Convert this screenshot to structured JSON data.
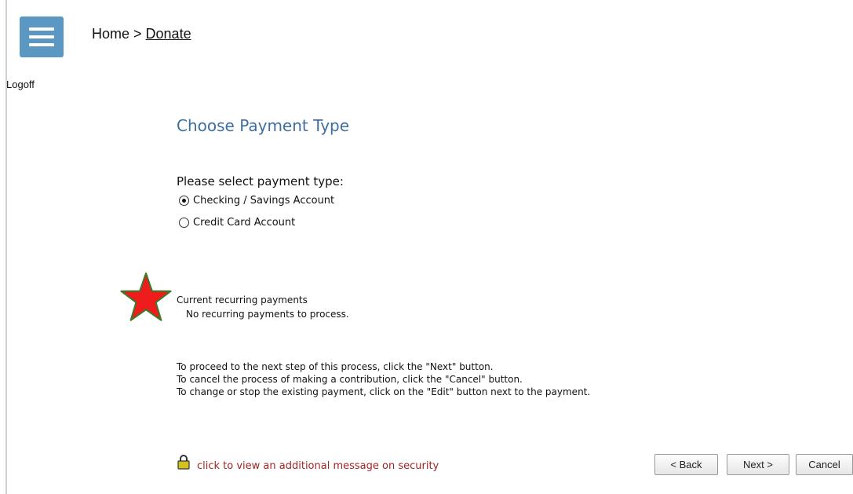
{
  "header": {
    "breadcrumb_home": "Home",
    "breadcrumb_separator": " > ",
    "breadcrumb_current": "Donate",
    "logoff_label": "Logoff"
  },
  "main": {
    "title": "Choose Payment Type",
    "select_prompt": "Please select payment type:",
    "payment_options": [
      {
        "label": "Checking / Savings Account",
        "selected": true
      },
      {
        "label": "Credit Card Account",
        "selected": false
      }
    ],
    "recurring": {
      "title": "Current recurring payments",
      "empty_message": "No recurring payments to process."
    },
    "instructions": [
      "To proceed to the next step of this process, click the \"Next\" button.",
      "To cancel the process of making a contribution, click the \"Cancel\" button.",
      "To change or stop the existing payment, click on the \"Edit\" button next to the payment."
    ],
    "security_link": "click to view an additional message on security"
  },
  "buttons": {
    "back": "< Back",
    "next": "Next >",
    "cancel": "Cancel"
  },
  "icons": {
    "menu": "hamburger-menu-icon",
    "star": "red-star-icon",
    "lock": "padlock-icon"
  },
  "colors": {
    "menu_button": "#5a97c2",
    "title": "#3f6ea0",
    "security_link": "#a32424",
    "star_fill": "#ee1c1c",
    "star_stroke": "#3a7a2a",
    "lock": "#d4c11a"
  }
}
